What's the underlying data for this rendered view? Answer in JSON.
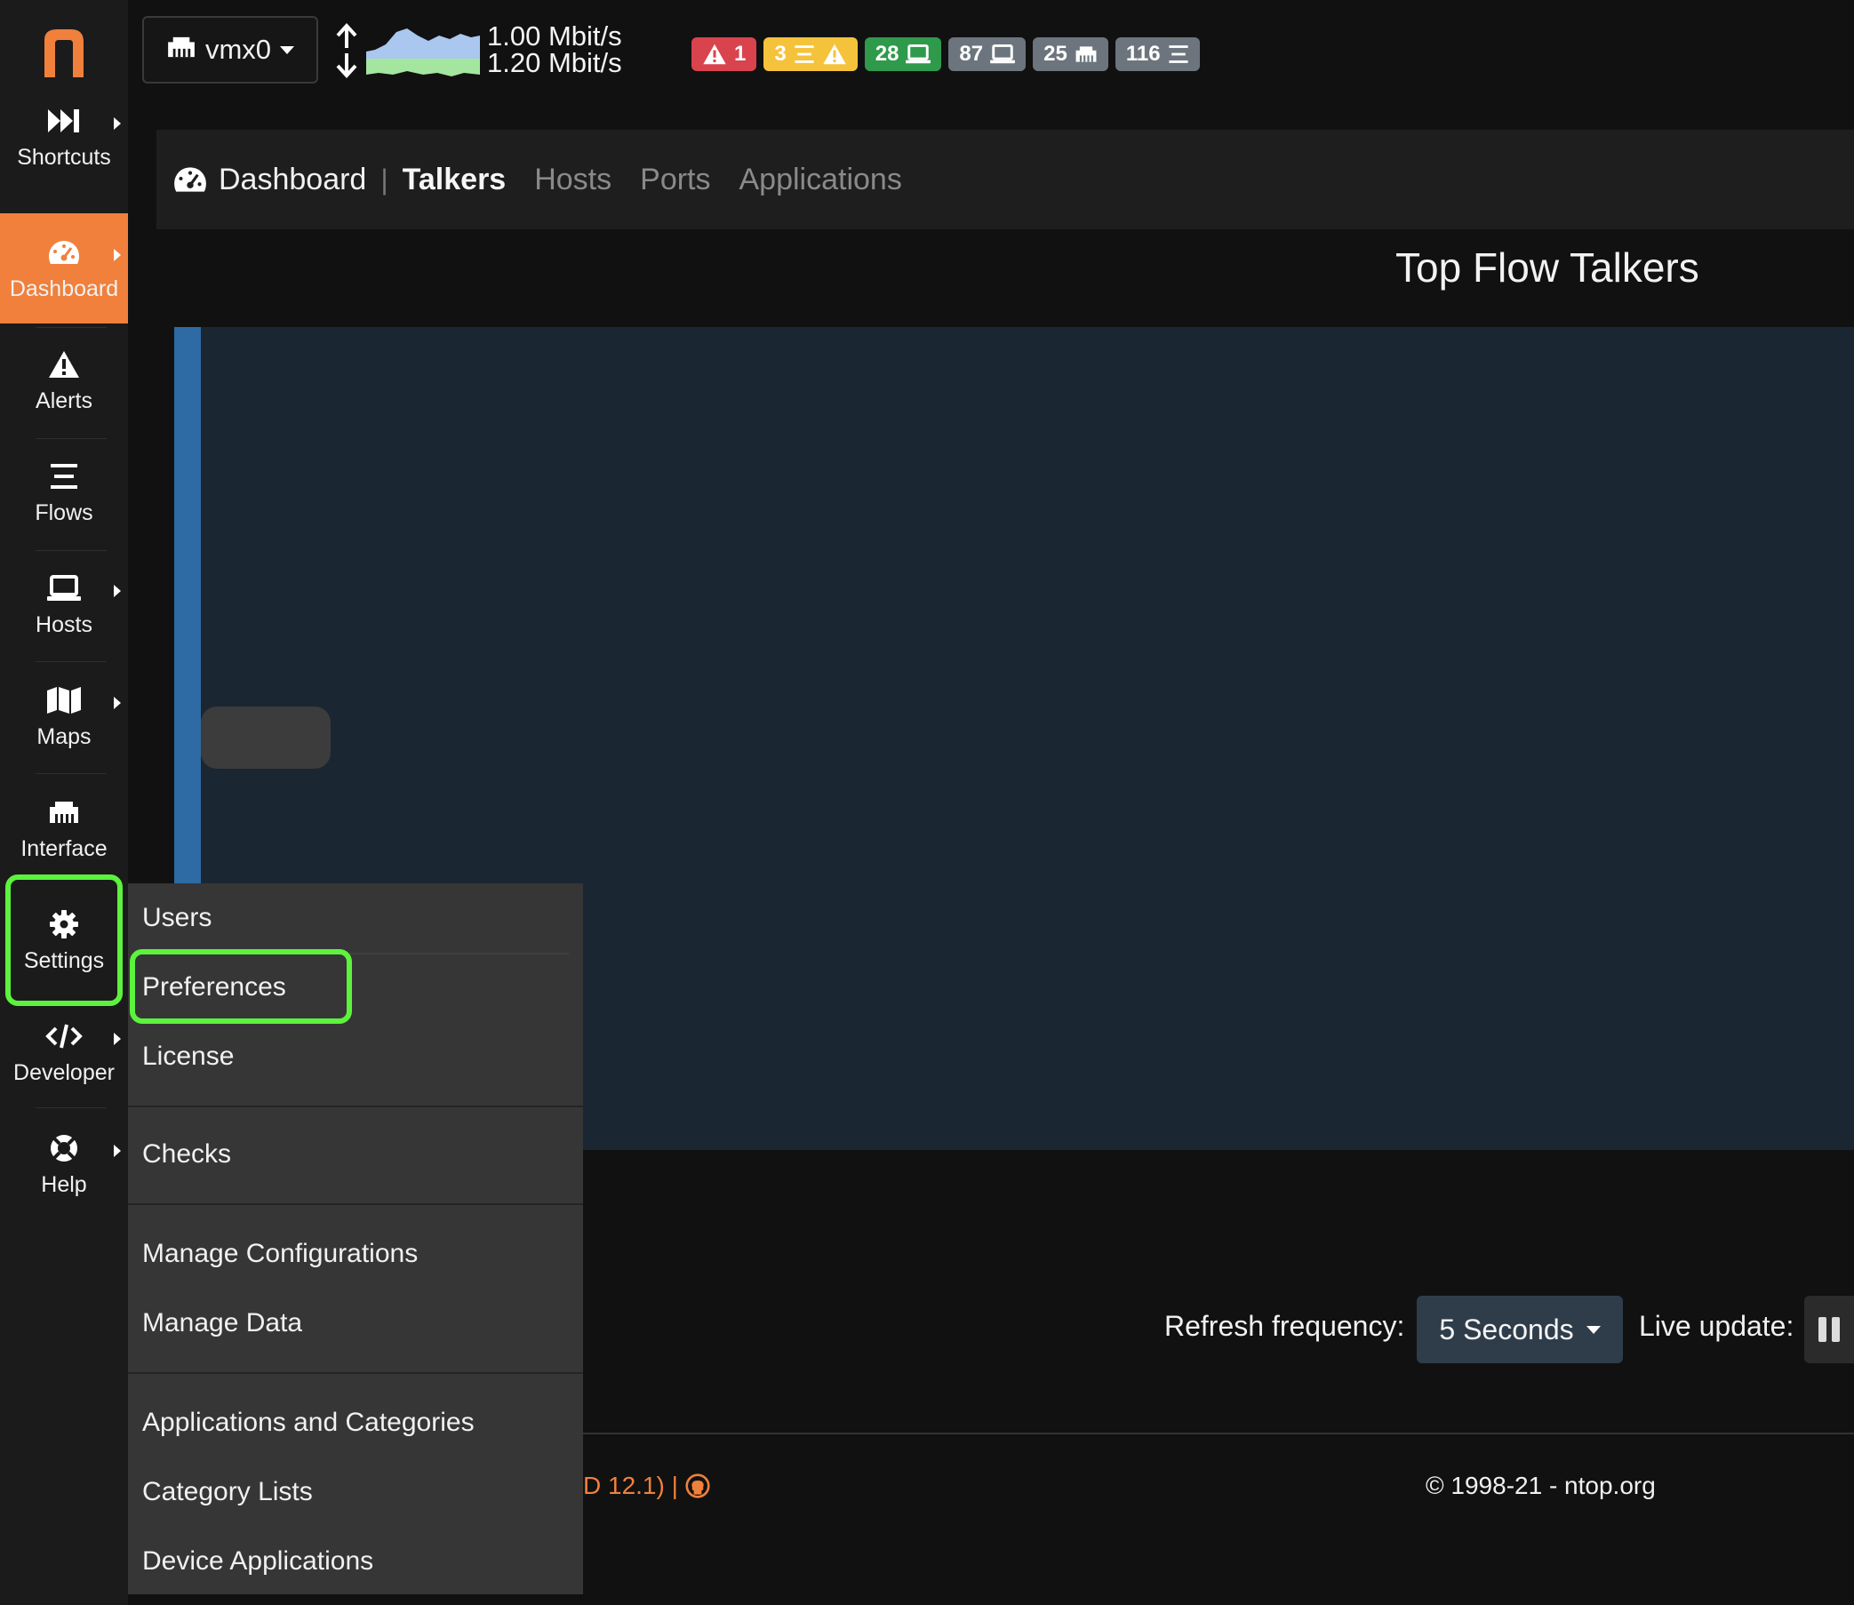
{
  "sidebar": {
    "items": [
      {
        "label": "Shortcuts",
        "icon": "fast-forward-icon"
      },
      {
        "label": "Dashboard",
        "icon": "gauge-icon"
      },
      {
        "label": "Alerts",
        "icon": "warning-icon"
      },
      {
        "label": "Flows",
        "icon": "list-icon"
      },
      {
        "label": "Hosts",
        "icon": "laptop-icon"
      },
      {
        "label": "Maps",
        "icon": "map-icon"
      },
      {
        "label": "Interface",
        "icon": "ethernet-icon"
      },
      {
        "label": "Settings",
        "icon": "gear-icon"
      },
      {
        "label": "Developer",
        "icon": "code-icon"
      },
      {
        "label": "Help",
        "icon": "life-ring-icon"
      }
    ]
  },
  "topbar": {
    "interface": "vmx0",
    "upload_rate": "1.00 Mbit/s",
    "download_rate": "1.20 Mbit/s",
    "badges": [
      {
        "count": "1",
        "icon": "warning-icon",
        "color": "#d9434e"
      },
      {
        "count": "3",
        "icon": "flow-warning-icon",
        "color": "#f5c33b"
      },
      {
        "count": "28",
        "icon": "laptop-icon",
        "color": "#2f9a4b"
      },
      {
        "count": "87",
        "icon": "laptop-icon",
        "color": "#6c757d"
      },
      {
        "count": "25",
        "icon": "ethernet-icon",
        "color": "#6c757d"
      },
      {
        "count": "116",
        "icon": "list-icon",
        "color": "#6c757d"
      }
    ]
  },
  "pagenav": {
    "title": "Dashboard",
    "tabs": [
      "Talkers",
      "Hosts",
      "Ports",
      "Applications"
    ],
    "active_tab": "Talkers"
  },
  "main": {
    "chart_title": "Top Flow Talkers",
    "refresh_label": "Refresh frequency:",
    "refresh_value": "5 Seconds",
    "live_update_label": "Live update:"
  },
  "settings_menu": {
    "items": [
      "Users",
      "Preferences",
      "License",
      "Checks",
      "Manage Configurations",
      "Manage Data",
      "Applications and Categories",
      "Category Lists",
      "Device Applications"
    ]
  },
  "footer": {
    "version_fragment": "D 12.1) |",
    "copyright": "© 1998-21 - ntop.org"
  },
  "colors": {
    "accent": "#f0803c",
    "highlight": "#5cf23d",
    "chart_bg": "#1a2632",
    "chart_bar": "#2e6aa3"
  }
}
